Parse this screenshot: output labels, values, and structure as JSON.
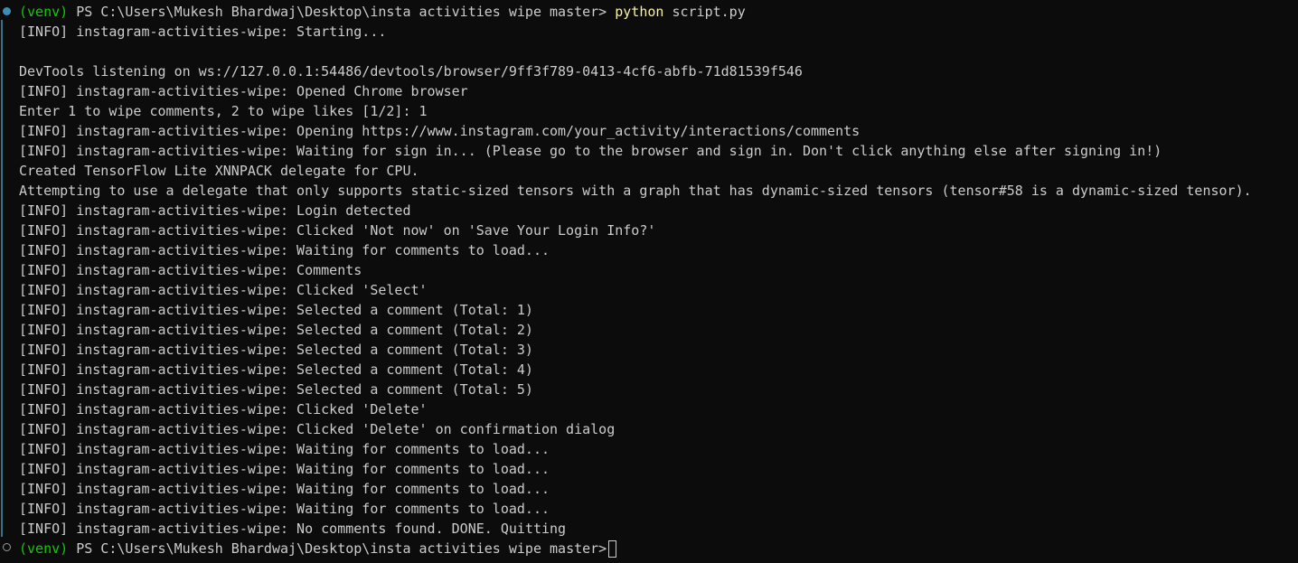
{
  "prompt": {
    "venv": "(venv)",
    "path": " PS C:\\Users\\Mukesh Bhardwaj\\Desktop\\insta activities wipe master> ",
    "command": "python",
    "args": " script.py"
  },
  "lines": [
    {
      "type": "info",
      "text": "[INFO] instagram-activities-wipe: Starting..."
    },
    {
      "type": "blank",
      "text": ""
    },
    {
      "type": "plain",
      "text": "DevTools listening on ws://127.0.0.1:54486/devtools/browser/9ff3f789-0413-4cf6-abfb-71d81539f546"
    },
    {
      "type": "info",
      "text": "[INFO] instagram-activities-wipe: Opened Chrome browser"
    },
    {
      "type": "plain",
      "text": "Enter 1 to wipe comments, 2 to wipe likes [1/2]: 1"
    },
    {
      "type": "info",
      "text": "[INFO] instagram-activities-wipe: Opening https://www.instagram.com/your_activity/interactions/comments"
    },
    {
      "type": "info",
      "text": "[INFO] instagram-activities-wipe: Waiting for sign in... (Please go to the browser and sign in. Don't click anything else after signing in!)"
    },
    {
      "type": "plain",
      "text": "Created TensorFlow Lite XNNPACK delegate for CPU."
    },
    {
      "type": "plain",
      "text": "Attempting to use a delegate that only supports static-sized tensors with a graph that has dynamic-sized tensors (tensor#58 is a dynamic-sized tensor)."
    },
    {
      "type": "info",
      "text": "[INFO] instagram-activities-wipe: Login detected"
    },
    {
      "type": "info",
      "text": "[INFO] instagram-activities-wipe: Clicked 'Not now' on 'Save Your Login Info?'"
    },
    {
      "type": "info",
      "text": "[INFO] instagram-activities-wipe: Waiting for comments to load..."
    },
    {
      "type": "info",
      "text": "[INFO] instagram-activities-wipe: Comments"
    },
    {
      "type": "info",
      "text": "[INFO] instagram-activities-wipe: Clicked 'Select'"
    },
    {
      "type": "info",
      "text": "[INFO] instagram-activities-wipe: Selected a comment (Total: 1)"
    },
    {
      "type": "info",
      "text": "[INFO] instagram-activities-wipe: Selected a comment (Total: 2)"
    },
    {
      "type": "info",
      "text": "[INFO] instagram-activities-wipe: Selected a comment (Total: 3)"
    },
    {
      "type": "info",
      "text": "[INFO] instagram-activities-wipe: Selected a comment (Total: 4)"
    },
    {
      "type": "info",
      "text": "[INFO] instagram-activities-wipe: Selected a comment (Total: 5)"
    },
    {
      "type": "info",
      "text": "[INFO] instagram-activities-wipe: Clicked 'Delete'"
    },
    {
      "type": "info",
      "text": "[INFO] instagram-activities-wipe: Clicked 'Delete' on confirmation dialog"
    },
    {
      "type": "info",
      "text": "[INFO] instagram-activities-wipe: Waiting for comments to load..."
    },
    {
      "type": "info",
      "text": "[INFO] instagram-activities-wipe: Waiting for comments to load..."
    },
    {
      "type": "info",
      "text": "[INFO] instagram-activities-wipe: Waiting for comments to load..."
    },
    {
      "type": "info",
      "text": "[INFO] instagram-activities-wipe: Waiting for comments to load..."
    },
    {
      "type": "info",
      "text": "[INFO] instagram-activities-wipe: No comments found. DONE. Quitting"
    }
  ],
  "final_prompt": {
    "venv": "(venv)",
    "path": " PS C:\\Users\\Mukesh Bhardwaj\\Desktop\\insta activities wipe master>"
  },
  "colors": {
    "background": "#0c0c0c",
    "text": "#cccccc",
    "venv": "#16c60c",
    "command": "#f9f1a5"
  }
}
